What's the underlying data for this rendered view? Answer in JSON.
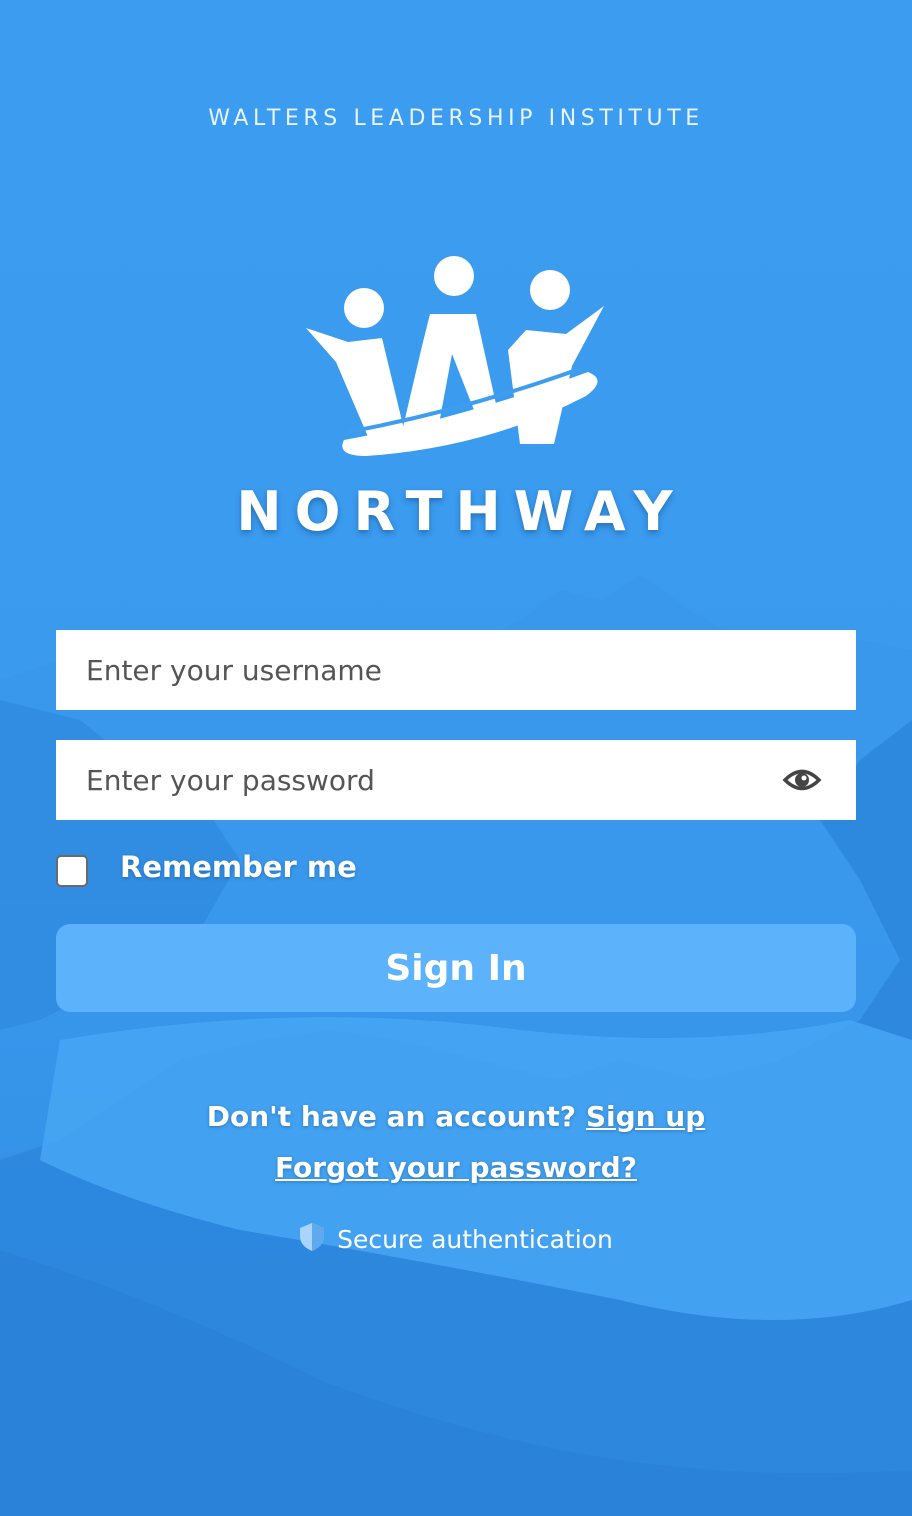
{
  "header": {
    "organization": "WALTERS LEADERSHIP INSTITUTE",
    "brand_name": "NORTHWAY",
    "logo_icon": "northway-w-people-logo"
  },
  "form": {
    "username_placeholder": "Enter your username",
    "password_placeholder": "Enter your password",
    "password_toggle_icon": "eye-icon",
    "remember_label": "Remember me",
    "remember_checked": false,
    "submit_label": "Sign In"
  },
  "footer": {
    "signup_prompt": "Don't have an account?",
    "signup_link": "Sign up",
    "forgot_link": "Forgot your password?",
    "secure_icon": "shield-icon",
    "secure_text": "Secure authentication"
  },
  "colors": {
    "background": "#3d9ef0",
    "button": "#5cb2fb",
    "text": "#ffffff"
  }
}
